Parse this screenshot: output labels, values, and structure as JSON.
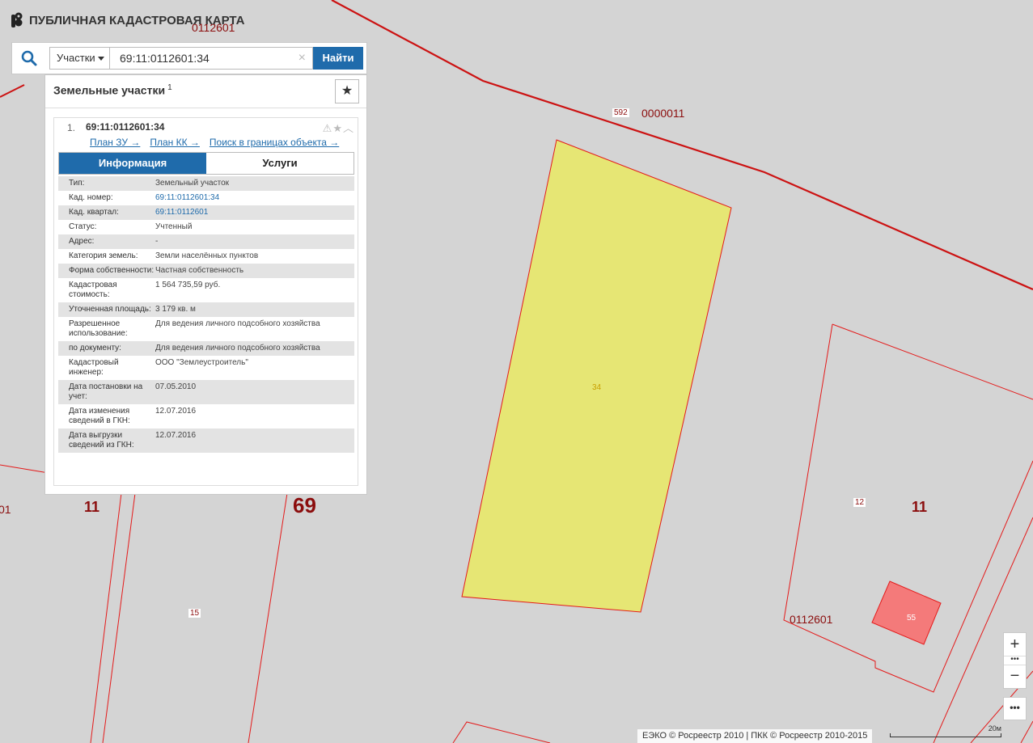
{
  "header": {
    "title": "ПУБЛИЧНАЯ КАДАСТРОВАЯ КАРТА"
  },
  "search": {
    "type_label": "Участки",
    "query": "69:11:0112601:34",
    "clear_glyph": "×",
    "find_label": "Найти"
  },
  "panel": {
    "title": "Земельные участки",
    "count": "1",
    "result": {
      "index": "1.",
      "number": "69:11:0112601:34",
      "links": [
        "План ЗУ →",
        "План КК →",
        "Поиск в границах объекта →"
      ],
      "tabs": {
        "info": "Информация",
        "services": "Услуги"
      },
      "rows": [
        {
          "label": "Тип:",
          "value": "Земельный участок"
        },
        {
          "label": "Кад. номер:",
          "value": "69:11:0112601:34"
        },
        {
          "label": "Кад. квартал:",
          "value": "69:11:0112601"
        },
        {
          "label": "Статус:",
          "value": "Учтенный"
        },
        {
          "label": "Адрес:",
          "value": "-"
        },
        {
          "label": "Категория земель:",
          "value": "Земли населённых пунктов"
        },
        {
          "label": "Форма собственности:",
          "value": "Частная собственность"
        },
        {
          "label": "Кадастровая стоимость:",
          "value": "1 564 735,59 руб."
        },
        {
          "label": "Уточненная площадь:",
          "value": "3 179 кв. м"
        },
        {
          "label": "Разрешенное использование:",
          "value": "Для ведения личного подсобного хозяйства"
        },
        {
          "label": "по документу:",
          "value": "Для ведения личного подсобного хозяйства"
        },
        {
          "label": "Кадастровый инженер:",
          "value": "ООО \"Землеустроитель\""
        },
        {
          "label": "Дата постановки на учет:",
          "value": "07.05.2010"
        },
        {
          "label": "Дата изменения сведений в ГКН:",
          "value": "12.07.2016"
        },
        {
          "label": "Дата выгрузки сведений из ГКН:",
          "value": "12.07.2016"
        }
      ]
    }
  },
  "map": {
    "labels": {
      "block_top": "0112601",
      "parcel_592": "592",
      "block_0000011": "0000011",
      "parcel_34": "34",
      "district_69": "69",
      "district_11_left": "11",
      "district_11_right": "11",
      "edge_01": "01",
      "parcel_12": "12",
      "parcel_15": "15",
      "block_right": "0112601",
      "parcel_55": "55"
    },
    "colors": {
      "background": "#d4d4d4",
      "boundary": "#e41a1a",
      "selected_fill": "#e6e674",
      "highlight_fill": "#f47a7a"
    }
  },
  "controls": {
    "zoom_in": "+",
    "zoom_out": "−",
    "dots": "•••",
    "more": "•••"
  },
  "attribution": "ЕЭКО © Росреестр 2010 | ПКК © Росреестр 2010-2015",
  "scale": "20м"
}
